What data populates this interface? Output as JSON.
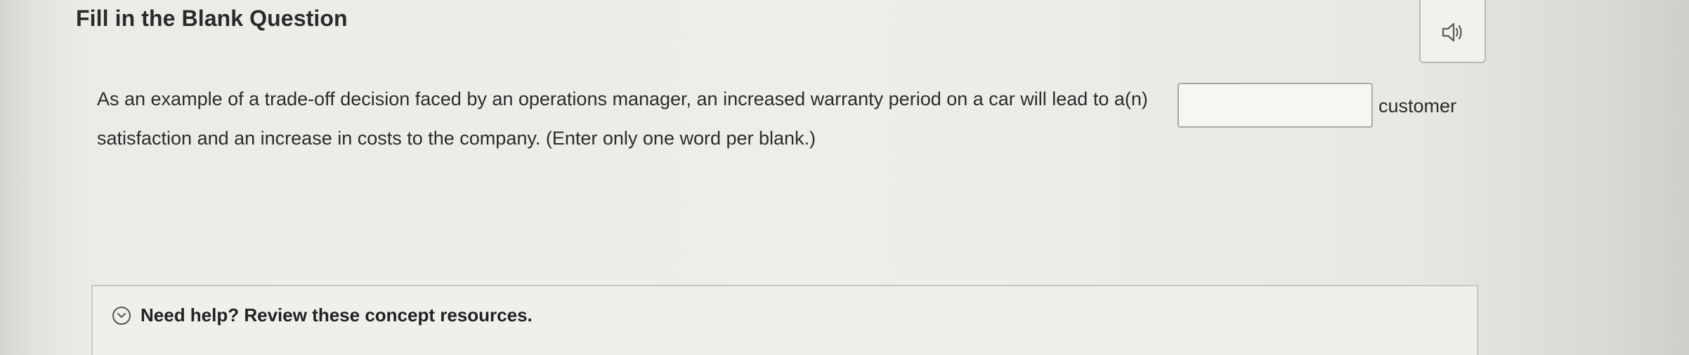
{
  "question": {
    "title": "Fill in the Blank Question",
    "text_before_blank": "As an example of a trade-off decision faced by an operations manager, an increased warranty period on a car will lead to a(n)",
    "blank": {
      "value": "",
      "placeholder": ""
    },
    "text_after_blank": "customer",
    "text_continued": "satisfaction and an increase in costs to the company. (Enter only one word per blank.)"
  },
  "audio_button": {
    "icon": "speaker-icon"
  },
  "help": {
    "icon": "chevron-down-circle-icon",
    "label": "Need help? Review these concept resources."
  }
}
